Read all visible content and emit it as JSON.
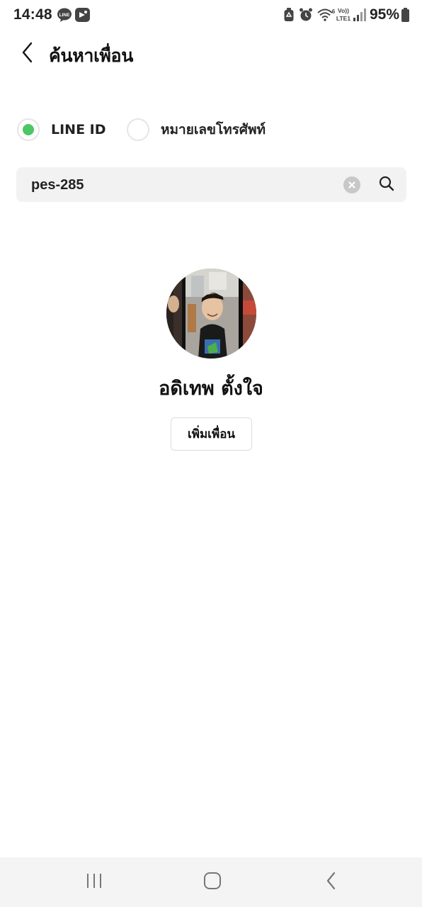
{
  "status_bar": {
    "time": "14:48",
    "battery_text": "95%",
    "left_icons": [
      "line-notification-icon",
      "chat-app-notification-icon"
    ],
    "right_icons": [
      "storage-icon",
      "alarm-clock-icon",
      "wifi-6-icon",
      "volte-lte1-icon",
      "signal-icon",
      "battery-icon"
    ],
    "volte_label": "Vo))",
    "lte_label": "LTE1",
    "line_badge": "LINE"
  },
  "header": {
    "title": "ค้นหาเพื่อน",
    "back_icon": "back-arrow-icon"
  },
  "search_type": {
    "options": [
      {
        "label": "LINE ID",
        "selected": true
      },
      {
        "label": "หมายเลขโทรศัพท์",
        "selected": false
      }
    ],
    "accent_color": "#4cc764"
  },
  "search": {
    "value": "pes-285",
    "clear_icon": "clear-icon",
    "search_icon": "search-icon"
  },
  "result": {
    "name": "อดิเทพ ตั้งใจ",
    "add_friend_label": "เพิ่มเพื่อน",
    "avatar_icon": "profile-photo"
  },
  "nav_bar": {
    "buttons": [
      "recent-apps-icon",
      "home-icon",
      "back-icon"
    ]
  }
}
